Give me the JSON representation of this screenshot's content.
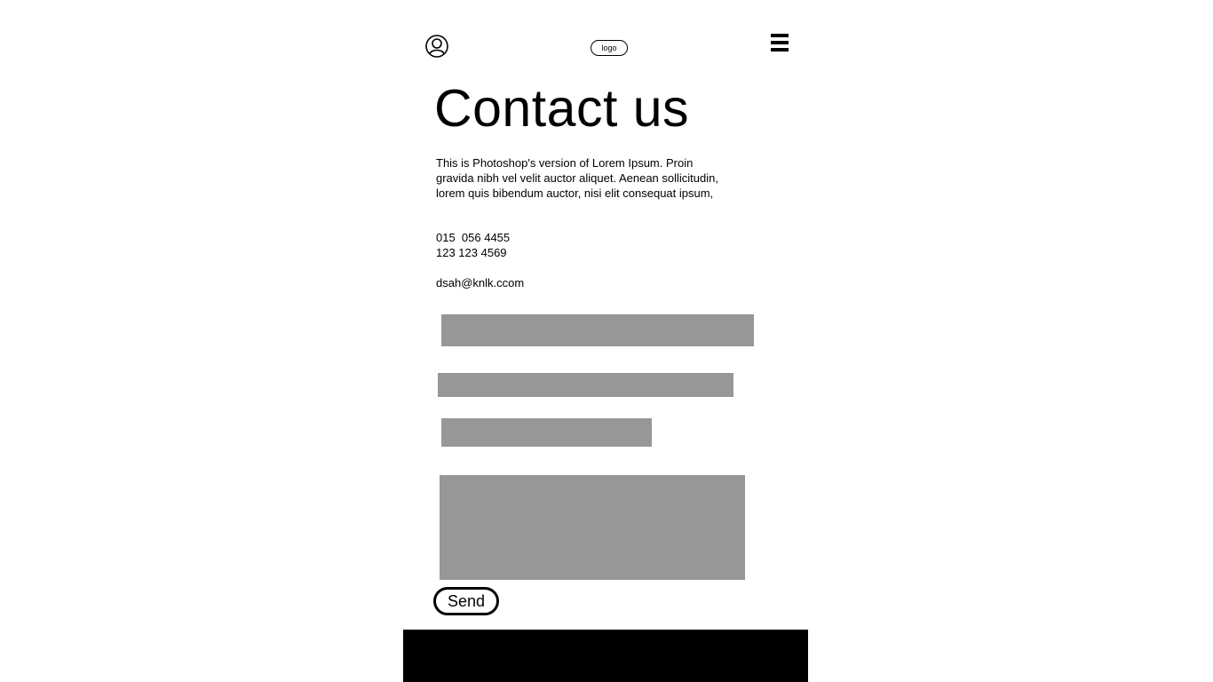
{
  "header": {
    "logo_text": "logo",
    "user_icon": "user-icon",
    "menu_icon": "hamburger-menu-icon"
  },
  "main": {
    "title": "Contact us",
    "intro_lines": [
      "This is Photoshop's version  of Lorem Ipsum. Proin",
      "gravida nibh vel velit auctor aliquet. Aenean sollicitudin,",
      "lorem quis bibendum auctor, nisi elit consequat ipsum,"
    ],
    "phones": [
      "015  056 4455",
      "123 123 4569"
    ],
    "email": "dsah@knlk.ccom"
  },
  "form": {
    "send_label": "Send",
    "field_color": "#979797"
  },
  "colors": {
    "footer": "#000000",
    "background": "#ffffff"
  }
}
